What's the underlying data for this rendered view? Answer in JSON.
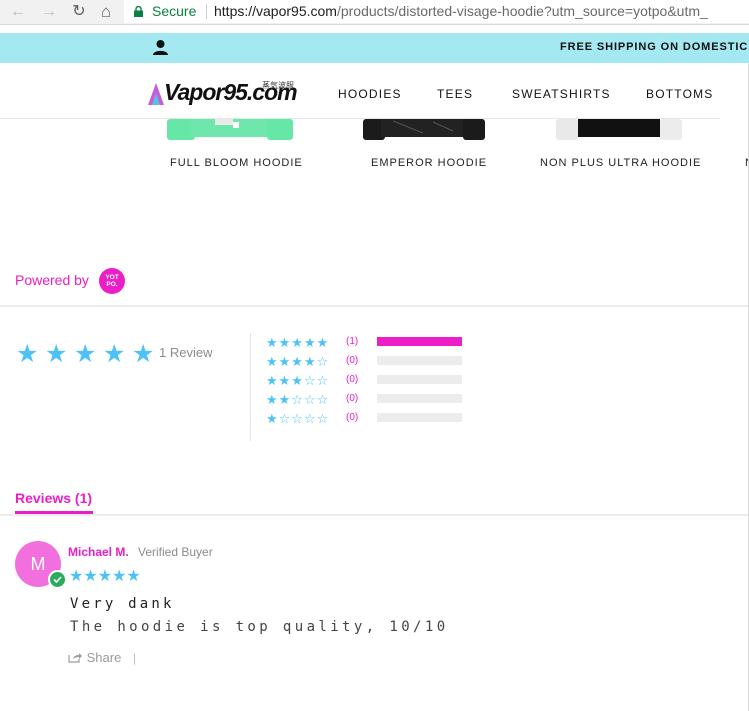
{
  "browser": {
    "secure_label": "Secure",
    "url_host": "https://vapor95.com",
    "url_path": "/products/distorted-visage-hoodie?utm_source=yotpo&utm_"
  },
  "promo": {
    "text": "FREE SHIPPING ON DOMESTIC O"
  },
  "logo": {
    "text": "Vapor95.com",
    "jp": "蒸気波服"
  },
  "nav": {
    "items": [
      "HOODIES",
      "TEES",
      "SWEATSHIRTS",
      "BOTTOMS"
    ]
  },
  "products": [
    {
      "name": "FULL BLOOM HOODIE"
    },
    {
      "name": "EMPEROR HOODIE"
    },
    {
      "name": "NON PLUS ULTRA HOODIE"
    },
    {
      "name": "N"
    }
  ],
  "yotpo": {
    "powered_by": "Powered by",
    "badge": "YOT PO."
  },
  "summary": {
    "average": 5,
    "review_count_label": "1 Review",
    "distribution": [
      {
        "stars": 5,
        "count_label": "(1)",
        "fraction": 1.0
      },
      {
        "stars": 4,
        "count_label": "(0)",
        "fraction": 0
      },
      {
        "stars": 3,
        "count_label": "(0)",
        "fraction": 0
      },
      {
        "stars": 2,
        "count_label": "(0)",
        "fraction": 0
      },
      {
        "stars": 1,
        "count_label": "(0)",
        "fraction": 0
      }
    ]
  },
  "reviews_tab": {
    "label": "Reviews (1)"
  },
  "review": {
    "avatar_letter": "M",
    "name": "Michael M.",
    "verified": "Verified Buyer",
    "rating": 5,
    "title": "Very dank",
    "body": "The hoodie is top quality, 10/10",
    "share_label": "Share",
    "share_sep": "|"
  },
  "colors": {
    "accent": "#ec1ec7",
    "star": "#4ec2f7",
    "promo_bg": "#a4e8f1",
    "verified": "#2cab5e"
  }
}
